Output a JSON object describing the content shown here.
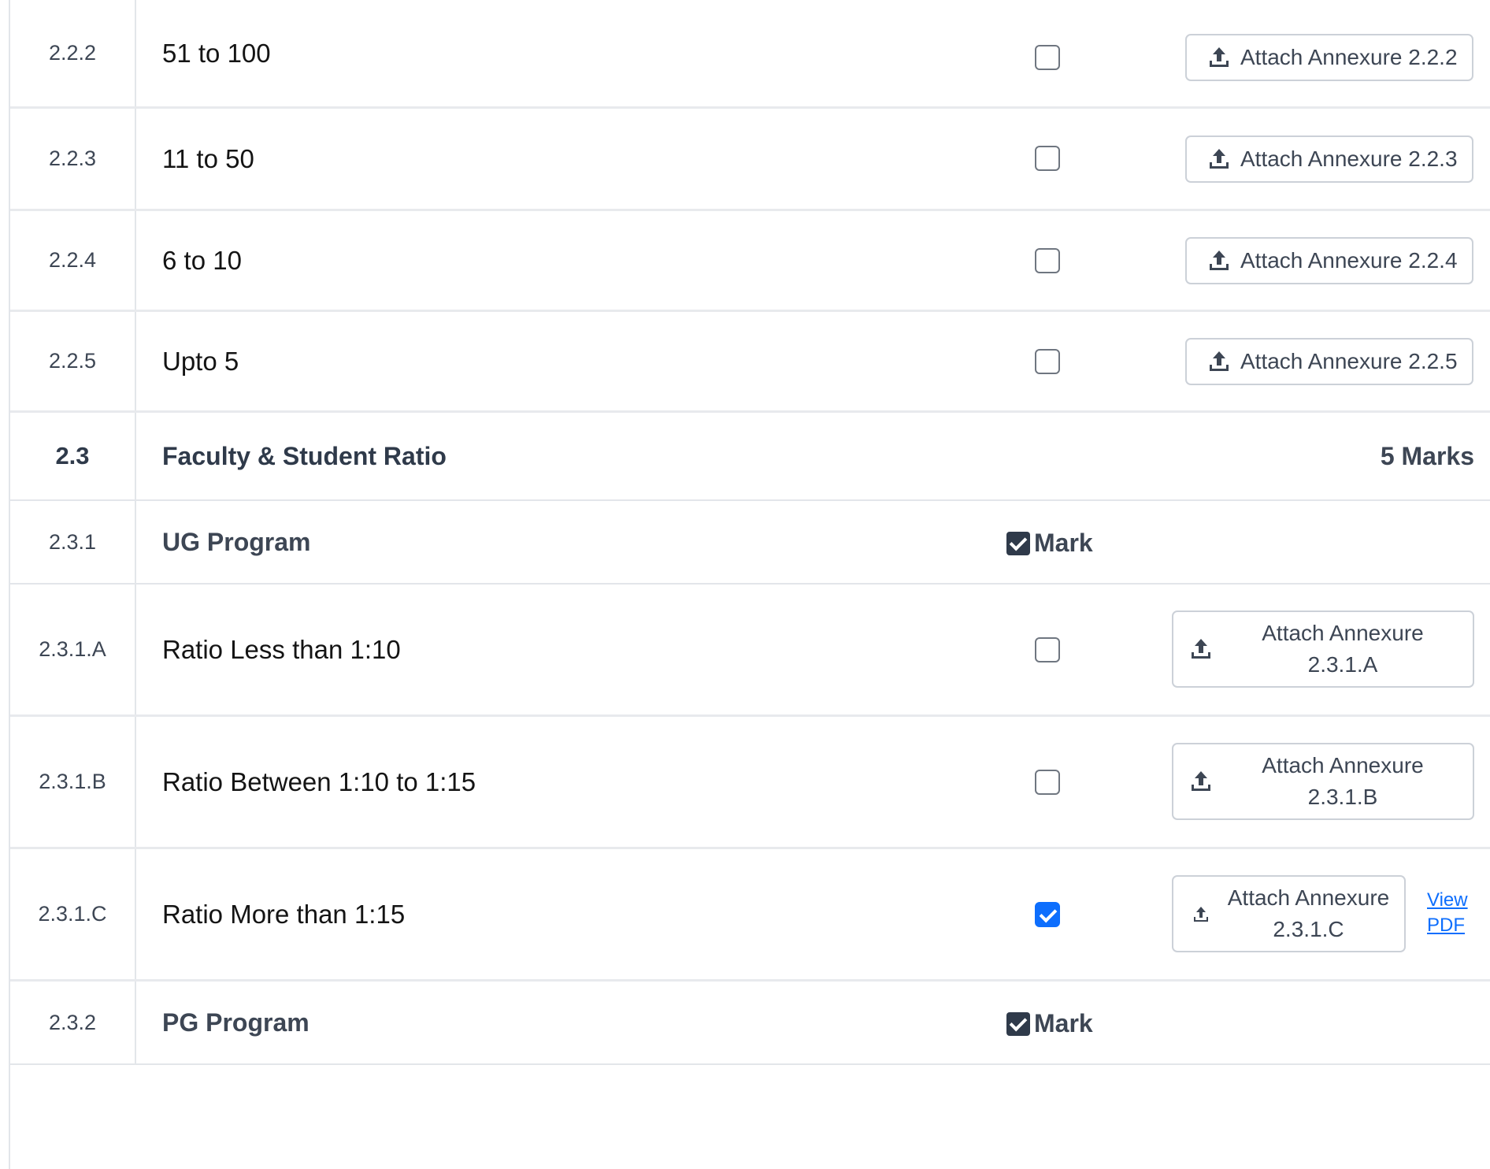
{
  "rows": [
    {
      "num": "2.2.2",
      "label": "51 to 100",
      "checked": false,
      "button": "Attach Annexure 2.2.2"
    },
    {
      "num": "2.2.3",
      "label": "11 to 50",
      "checked": false,
      "button": "Attach Annexure 2.2.3"
    },
    {
      "num": "2.2.4",
      "label": "6 to 10",
      "checked": false,
      "button": "Attach Annexure 2.2.4"
    },
    {
      "num": "2.2.5",
      "label": "Upto 5",
      "checked": false,
      "button": "Attach Annexure 2.2.5"
    }
  ],
  "section": {
    "num": "2.3",
    "title": "Faculty & Student Ratio",
    "marks": "5 Marks"
  },
  "ug": {
    "num": "2.3.1",
    "title": "UG Program",
    "mark_label": "Mark",
    "items": [
      {
        "num": "2.3.1.A",
        "label": "Ratio Less than 1:10",
        "checked": false,
        "button": "Attach Annexure\n2.3.1.A"
      },
      {
        "num": "2.3.1.B",
        "label": "Ratio Between 1:10 to 1:15",
        "checked": false,
        "button": "Attach Annexure\n2.3.1.B"
      },
      {
        "num": "2.3.1.C",
        "label": "Ratio More than 1:15",
        "checked": true,
        "button": "Attach Annexure\n2.3.1.C",
        "link": "View\nPDF"
      }
    ]
  },
  "pg": {
    "num": "2.3.2",
    "title": "PG Program",
    "mark_label": "Mark"
  },
  "colors": {
    "accent": "#0d6efd",
    "text_dark": "#2f3a4a",
    "border": "#e3e6ea"
  },
  "icons": {
    "attach": "upload-icon",
    "mark": "checkbox-checked-icon"
  }
}
